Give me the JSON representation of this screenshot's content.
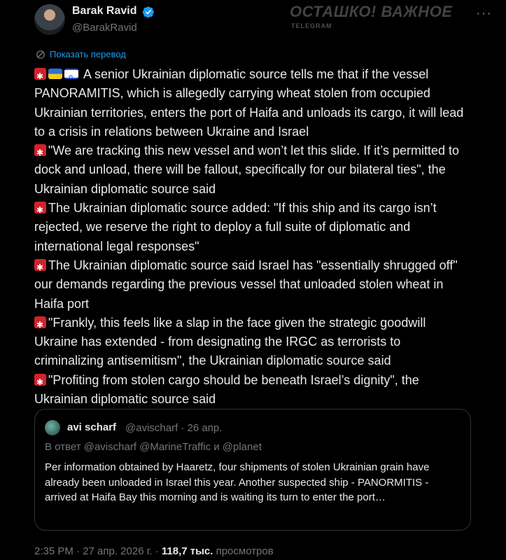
{
  "author": {
    "name": "Barak Ravid",
    "handle": "@BarakRavid",
    "verified": true
  },
  "more_glyph": "···",
  "watermark": {
    "title": "ОСТАШКО! ВАЖНОЕ",
    "subtitle": "TELEGRAM"
  },
  "translate_label": "Показать перевод",
  "paragraphs": [
    {
      "prefix": "siren-flags",
      "text": " A senior Ukrainian diplomatic source tells me that if the vessel PANORAMITIS, which is allegedly carrying wheat stolen from occupied Ukrainian territories, enters the port of Haifa and unloads its cargo, it will lead to a crisis in relations between Ukraine and Israel"
    },
    {
      "prefix": "siren",
      "text": "\"We are tracking this new vessel and won’t let this slide. If it’s permitted to dock and unload, there will be fallout, specifically for our bilateral ties\", the Ukrainian diplomatic source said"
    },
    {
      "prefix": "siren",
      "text": "The Ukrainian diplomatic source added: \"If this ship and its cargo isn’t rejected, we reserve the right to deploy a full suite of diplomatic and international legal responses\""
    },
    {
      "prefix": "siren",
      "text": "The Ukrainian diplomatic source said Israel has \"essentially shrugged off\" our demands regarding the previous vessel that unloaded stolen wheat in Haifa port"
    },
    {
      "prefix": "siren",
      "text": "\"Frankly, this feels like a slap in the face given the strategic goodwill Ukraine has extended - from designating the IRGC as terrorists to criminalizing antisemitism\", the Ukrainian diplomatic source said"
    },
    {
      "prefix": "siren",
      "text": "\"Profiting from stolen cargo should be beneath Israel’s dignity\", the Ukrainian diplomatic source said"
    }
  ],
  "quote": {
    "name": "avi scharf",
    "handle_date": "@avischarf · 26 апр.",
    "reply_line": "В ответ @avischarf @MarineTraffic и @planet",
    "text": "Per information obtained by Haaretz, four shipments of stolen Ukrainian grain have already been unloaded in Israel this year. Another suspected ship - PANORMITIS - arrived at Haifa Bay this morning and is waiting its turn to enter the port…"
  },
  "meta": {
    "time_date": "2:35 PM · 27 апр. 2026 г. · ",
    "views_count": "118,7 тыс.",
    "views_label": " просмотров"
  },
  "colors": {
    "accent": "#1d9bf0",
    "background": "#000000",
    "muted": "#71767b"
  },
  "icons": [
    "verified-badge-icon",
    "translate-icon",
    "siren-emoji-icon",
    "ukraine-flag-icon",
    "israel-flag-icon"
  ]
}
